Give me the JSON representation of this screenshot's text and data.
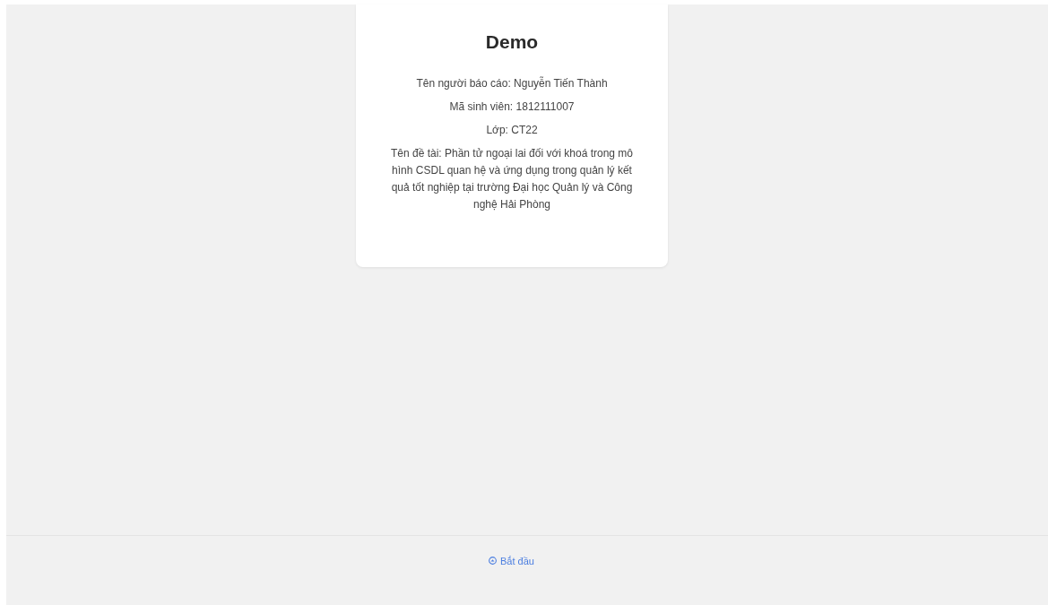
{
  "card": {
    "title": "Demo",
    "lines": [
      "Tên người báo cáo: Nguyễn Tiến Thành",
      "Mã sinh viên: 1812111007",
      "Lớp: CT22",
      "Tên đề tài: Phần tử ngoại lai đối với khoá trong mô hình CSDL quan hệ và ứng dụng trong quản lý kết quả tốt nghiệp tại trường Đại học Quản lý và Công nghệ Hải Phòng"
    ]
  },
  "footer": {
    "link": "Bắt đầu"
  }
}
